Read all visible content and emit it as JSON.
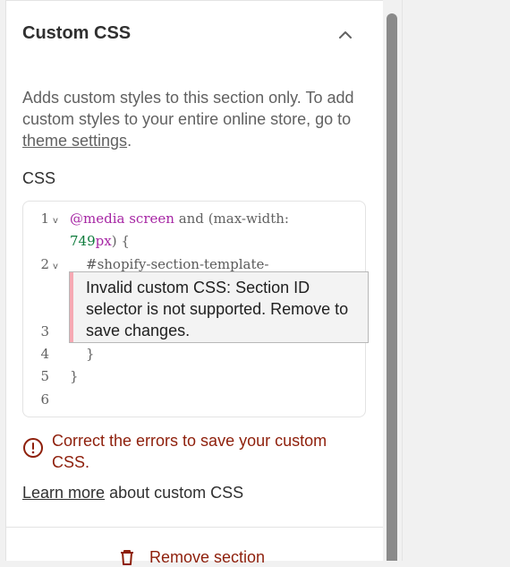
{
  "section": {
    "title": "Custom CSS",
    "description_before_link": "Adds custom styles to this section only. To add custom styles to your entire online store, go to ",
    "description_link": "theme settings",
    "description_after_link": ".",
    "css_label": "CSS"
  },
  "editor": {
    "line_numbers": [
      "1",
      "2",
      "3",
      "4",
      "5",
      "6"
    ],
    "fold_marker": "v",
    "line1_at_media": "@media",
    "line1_screen": "screen",
    "line1_and": "and",
    "line1_paren": "(max-width:",
    "line1b_num": "749",
    "line1b_unit": "px",
    "line1b_rest": ") {",
    "line2_selector": "#shopify-section-template-",
    "line4": "}",
    "line5": "}"
  },
  "tooltip": {
    "message": "Invalid custom CSS: Section ID selector is not supported. Remove to save changes."
  },
  "error": {
    "icon": "error-circle-icon",
    "message": "Correct the errors to save your custom CSS."
  },
  "learn_more": {
    "link": "Learn more",
    "rest": " about custom CSS"
  },
  "remove_button": {
    "icon": "trash-icon",
    "label": "Remove section"
  },
  "colors": {
    "error_red": "#8e1f0b",
    "tooltip_bar": "#f6a9b3",
    "scrollbar": "#8a8a8a"
  }
}
